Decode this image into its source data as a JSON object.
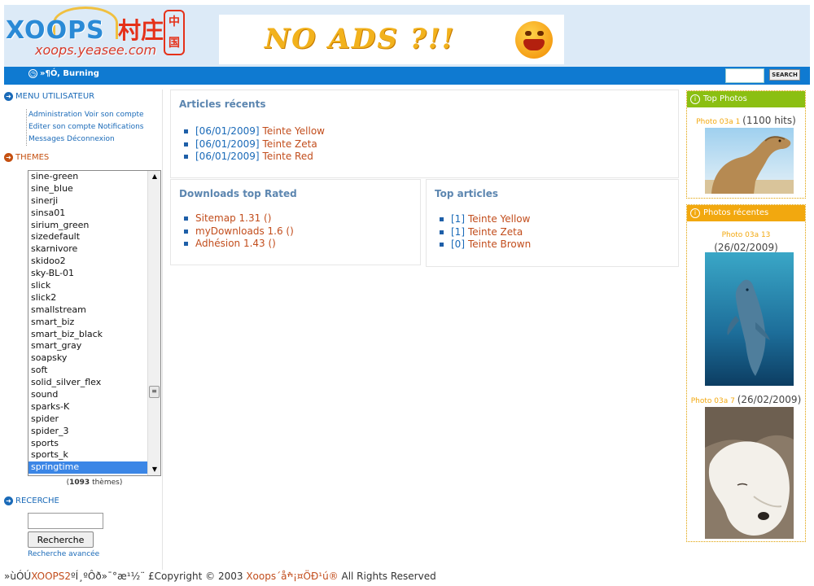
{
  "header": {
    "logo_main": "XOOPS",
    "logo_chinese": "村庄",
    "logo_stamp": "中国",
    "logo_url": "xoops.yeasee.com",
    "banner_text": "NO ADS ?!!"
  },
  "navbar": {
    "current_label": "»¶Ó, Burning",
    "search_button": "SEARCH"
  },
  "usermenu": {
    "title": "MENU UTILISATEUR",
    "links": [
      "Administration",
      "Voir son compte",
      "Editer son compte",
      "Notifications",
      "Messages",
      "Déconnexion"
    ]
  },
  "themes": {
    "title": "THEMES",
    "items": [
      "sine-green",
      "sine_blue",
      "sinerji",
      "sinsa01",
      "sirium_green",
      "sizedefault",
      "skarnivore",
      "skidoo2",
      "sky-BL-01",
      "slick",
      "slick2",
      "smallstream",
      "smart_biz",
      "smart_biz_black",
      "smart_gray",
      "soapsky",
      "soft",
      "solid_silver_flex",
      "sound",
      "sparks-K",
      "spider",
      "spider_3",
      "sports",
      "sports_k",
      "springtime"
    ],
    "selected": "springtime",
    "count": "1093",
    "count_suffix": "thèmes"
  },
  "search_block": {
    "title": "RECERCHE",
    "button": "Recherche",
    "advanced": "Recherche avancée"
  },
  "articles_recent": {
    "title": "Articles récents",
    "items": [
      {
        "date": "[06/01/2009]",
        "title": "Teinte Yellow"
      },
      {
        "date": "[06/01/2009]",
        "title": "Teinte Zeta"
      },
      {
        "date": "[06/01/2009]",
        "title": "Teinte Red"
      }
    ]
  },
  "downloads_top": {
    "title": "Downloads top Rated",
    "items": [
      "Sitemap 1.31 ()",
      "myDownloads 1.6 ()",
      "Adhésion 1.43 ()"
    ]
  },
  "top_articles": {
    "title": "Top articles",
    "items": [
      {
        "count": "[1]",
        "title": "Teinte Yellow"
      },
      {
        "count": "[1]",
        "title": "Teinte Zeta"
      },
      {
        "count": "[0]",
        "title": "Teinte Brown"
      }
    ]
  },
  "top_photos": {
    "title": "Top Photos",
    "caption_name": "Photo 03a 1",
    "caption_value": "(1100 hits)"
  },
  "recent_photos": {
    "title": "Photos récentes",
    "items": [
      {
        "name": "Photo 03a 13",
        "date": "(26/02/2009)"
      },
      {
        "name": "Photo 03a 7",
        "date": "(26/02/2009)"
      }
    ]
  },
  "footer": {
    "prefix": "»ùÓÚ",
    "brand": "XOOPS2",
    "middle": "ºÍ¸ºÔð»¯°æ¹½¨ £Copyright © 2003 ",
    "owner": "Xoops´åׯ¡¤ÖÐ¹ú®",
    "suffix": " All Rights Reserved"
  },
  "colors": {
    "nav_blue": "#0f7ad1",
    "header_bg": "#dceaf7",
    "link_orange": "#c24d1c",
    "link_blue": "#1a6ab8",
    "top_photos_head": "#8bbf12",
    "recent_photos_head": "#f2a80f"
  }
}
